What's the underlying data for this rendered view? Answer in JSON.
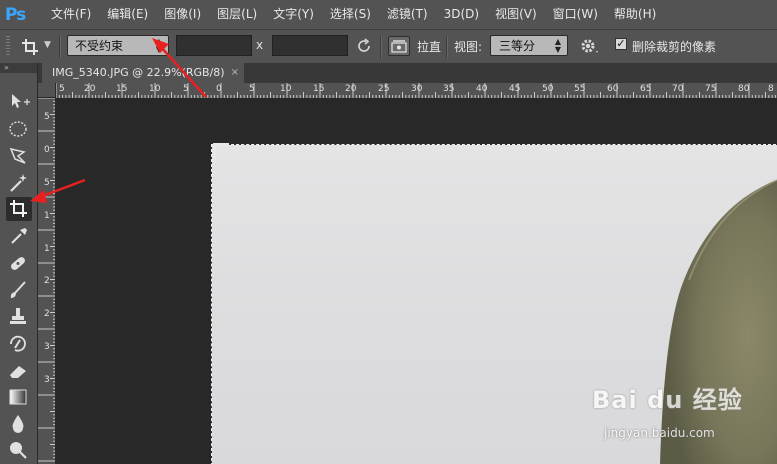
{
  "app": {
    "logo": "Ps"
  },
  "menu": [
    "文件(F)",
    "编辑(E)",
    "图像(I)",
    "图层(L)",
    "文字(Y)",
    "选择(S)",
    "滤镜(T)",
    "3D(D)",
    "视图(V)",
    "窗口(W)",
    "帮助(H)"
  ],
  "options": {
    "ratio_select": "不受约束",
    "width_value": "",
    "height_value": "",
    "x_separator": "x",
    "straighten_label": "拉直",
    "view_label": "视图:",
    "view_select": "三等分",
    "delete_cropped_checked": true,
    "delete_cropped_label": "删除裁剪的像素"
  },
  "document": {
    "tab_title": "IMG_5340.JPG @ 22.9%(RGB/8)",
    "close": "×"
  },
  "ruler": {
    "top": [
      "5",
      "20",
      "15",
      "10",
      "5",
      "0",
      "5",
      "10",
      "15",
      "20",
      "25",
      "30",
      "35",
      "40",
      "45",
      "50",
      "55",
      "60",
      "65",
      "70",
      "75",
      "80",
      "8"
    ],
    "left": [
      "5",
      "0",
      "5",
      "1",
      "1",
      "2",
      "2",
      "3",
      "3"
    ]
  },
  "watermark": {
    "main": "Bai du 经验",
    "sub": "jingyan.baidu.com"
  },
  "colors": {
    "accent": "#3aa6ff",
    "panel": "#535353",
    "canvas_bg": "#282828",
    "arrow": "#e8201f",
    "leather": "#7b7a5c"
  },
  "tools": [
    "move-icon",
    "marquee-icon",
    "lasso-icon",
    "magic-wand-icon",
    "crop-icon",
    "eyedropper-icon",
    "healing-brush-icon",
    "brush-icon",
    "clone-stamp-icon",
    "history-brush-icon",
    "eraser-icon",
    "gradient-icon",
    "blur-icon",
    "dodge-icon"
  ]
}
